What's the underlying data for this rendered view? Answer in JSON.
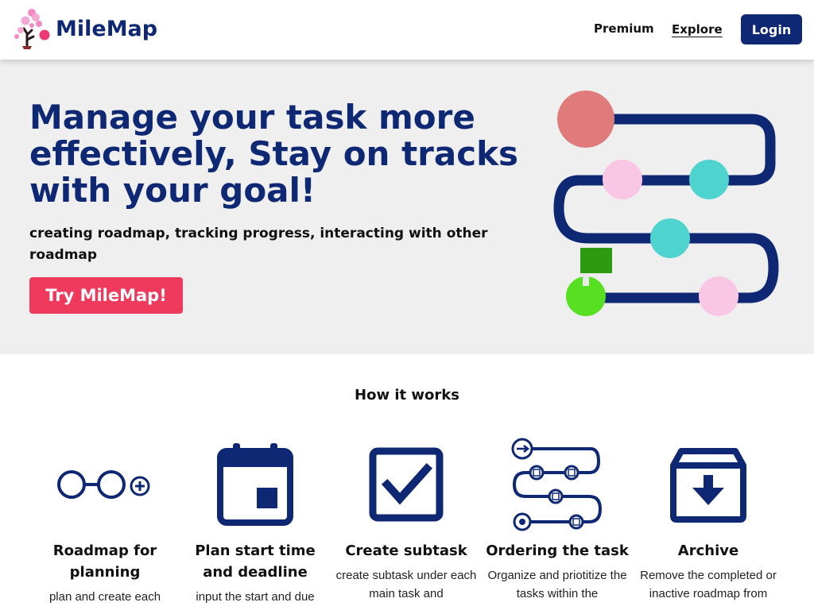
{
  "header": {
    "brand": "MileMap",
    "nav": {
      "premium": "Premium",
      "explore": "Explore",
      "login": "Login"
    }
  },
  "hero": {
    "title": "Manage your task more effectively, Stay on tracks with your goal!",
    "subtitle": "creating roadmap, tracking progress, interacting with other roadmap",
    "cta": "Try MileMap!"
  },
  "how_it_works": {
    "title": "How it works",
    "features": [
      {
        "icon": "roadmap-nodes-icon",
        "title": "Roadmap for planning",
        "desc": "plan and create each"
      },
      {
        "icon": "calendar-icon",
        "title": "Plan start time and deadline",
        "desc": "input the start and due"
      },
      {
        "icon": "checkbox-icon",
        "title": "Create subtask",
        "desc": "create subtask under each main task and"
      },
      {
        "icon": "ordering-path-icon",
        "title": "Ordering the task",
        "desc": "Organize and priotitize the tasks within the"
      },
      {
        "icon": "archive-icon",
        "title": "Archive",
        "desc": "Remove the completed or inactive roadmap from"
      }
    ]
  },
  "colors": {
    "brand_navy": "#0f2874",
    "cta_pink": "#ef3a5d",
    "hero_bg": "#efefef",
    "node_salmon": "#e07b7b",
    "node_pink": "#f9c6e3",
    "node_teal": "#4fd3cf",
    "node_green": "#57e022",
    "flag_green": "#2e9a0f"
  }
}
